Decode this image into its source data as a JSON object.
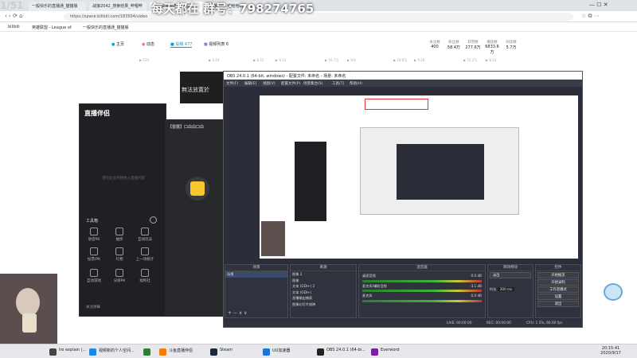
{
  "watermark": "每天都在 群号：798274765",
  "window_overlay_title": "1/51",
  "browser": {
    "tabs": [
      "一般快乐的直播通_猫猫版",
      "战狼2042_搜索结果_哔哩哔",
      "一般快乐的直播通_猫",
      "哈哈哈_哈哈哈的..."
    ],
    "url": "https://space.bilibili.com/183504/video",
    "bookmarks": [
      "bilibili",
      "英雄联盟 - League of",
      "一般快乐的直播通_猫猫版"
    ]
  },
  "space": {
    "nav": [
      "主页",
      "动态",
      "投稿 477",
      "视频列表 6"
    ],
    "stats": [
      {
        "label": "关注数",
        "value": "400"
      },
      {
        "label": "粉丝数",
        "value": "58.4万"
      },
      {
        "label": "获赞数",
        "value": "277.6万"
      },
      {
        "label": "播放数",
        "value": "6833.6万"
      },
      {
        "label": "阅读数",
        "value": "5.7万"
      }
    ],
    "row_top": [
      "▶ 120",
      "▶ 9.14",
      "▶ 8.32",
      "▶ 9.11",
      "▶ 16.7万",
      "▶ 9.8",
      "▶ 14.8万",
      "▶ 9.16",
      "▶ 55.2万",
      "▶ 8.22"
    ],
    "thumb_text": "無法放置於"
  },
  "live_companion": {
    "title": "直播伴侣",
    "room_title": "【雷霆】口白白口白",
    "empty_text": "请在此处开始接入直播内容",
    "tools_header": "工具箱",
    "tools": [
      "语音PK",
      "抽奖",
      "互动玩法",
      "投票/PK",
      "礼物",
      "上一场统计",
      "互动游戏",
      "分屏PK",
      "福利社"
    ],
    "footer": "关注弹幕"
  },
  "obs": {
    "window_title": "OBS 24.0.1 (64-bit, windows) - 配置文件: 未命名 - 场景: 未命名",
    "menu": [
      "文件(F)",
      "编辑(E)",
      "视图(V)",
      "配置文件(P)",
      "场景集合(S)",
      "工具(T)",
      "帮助(H)"
    ],
    "docks": {
      "scenes": {
        "header": "场景",
        "items": [
          "场景"
        ]
      },
      "sources": {
        "header": "来源",
        "items": [
          "图像 2",
          "图像",
          "文本 (GDI+) 2",
          "文本 (GDI+)",
          "直播输出捕获",
          "图像幻灯片放映"
        ]
      },
      "mixer": {
        "header": "混音器",
        "tracks": [
          {
            "name": "桌面音频",
            "level": "0.0 dB"
          },
          {
            "name": "麦克风/辅助音频",
            "level": "-3.1 dB"
          },
          {
            "name": "麦克风",
            "level": "0.0 dB"
          }
        ]
      },
      "transitions": {
        "header": "转场特效",
        "mode": "淡出",
        "duration_label": "时长",
        "duration": "300 ms"
      },
      "controls": {
        "header": "控件",
        "buttons": [
          "开始推流",
          "开始录制",
          "工作室模式",
          "设置",
          "退出"
        ]
      }
    },
    "status": {
      "live": "LIVE: 00:00:00",
      "rec": "REC: 00:00:00",
      "cpu": "CPU: 1.5%, 60.00 fps"
    }
  },
  "taskbar": {
    "items": [
      "Iro explain |...",
      "视频新的个人空间...",
      "斗鱼直播伴侣",
      "Steam",
      "UU加速器",
      "OBS 24.0.1 (64-bi...",
      "Everword"
    ],
    "time": "20:15:41",
    "date": "2020/9/17"
  },
  "colors": {
    "bilibili_pink": "#fb7299",
    "bilibili_blue": "#00a1d6",
    "obs_bg": "#2b2e38",
    "live_yellow": "#f6c72e"
  }
}
